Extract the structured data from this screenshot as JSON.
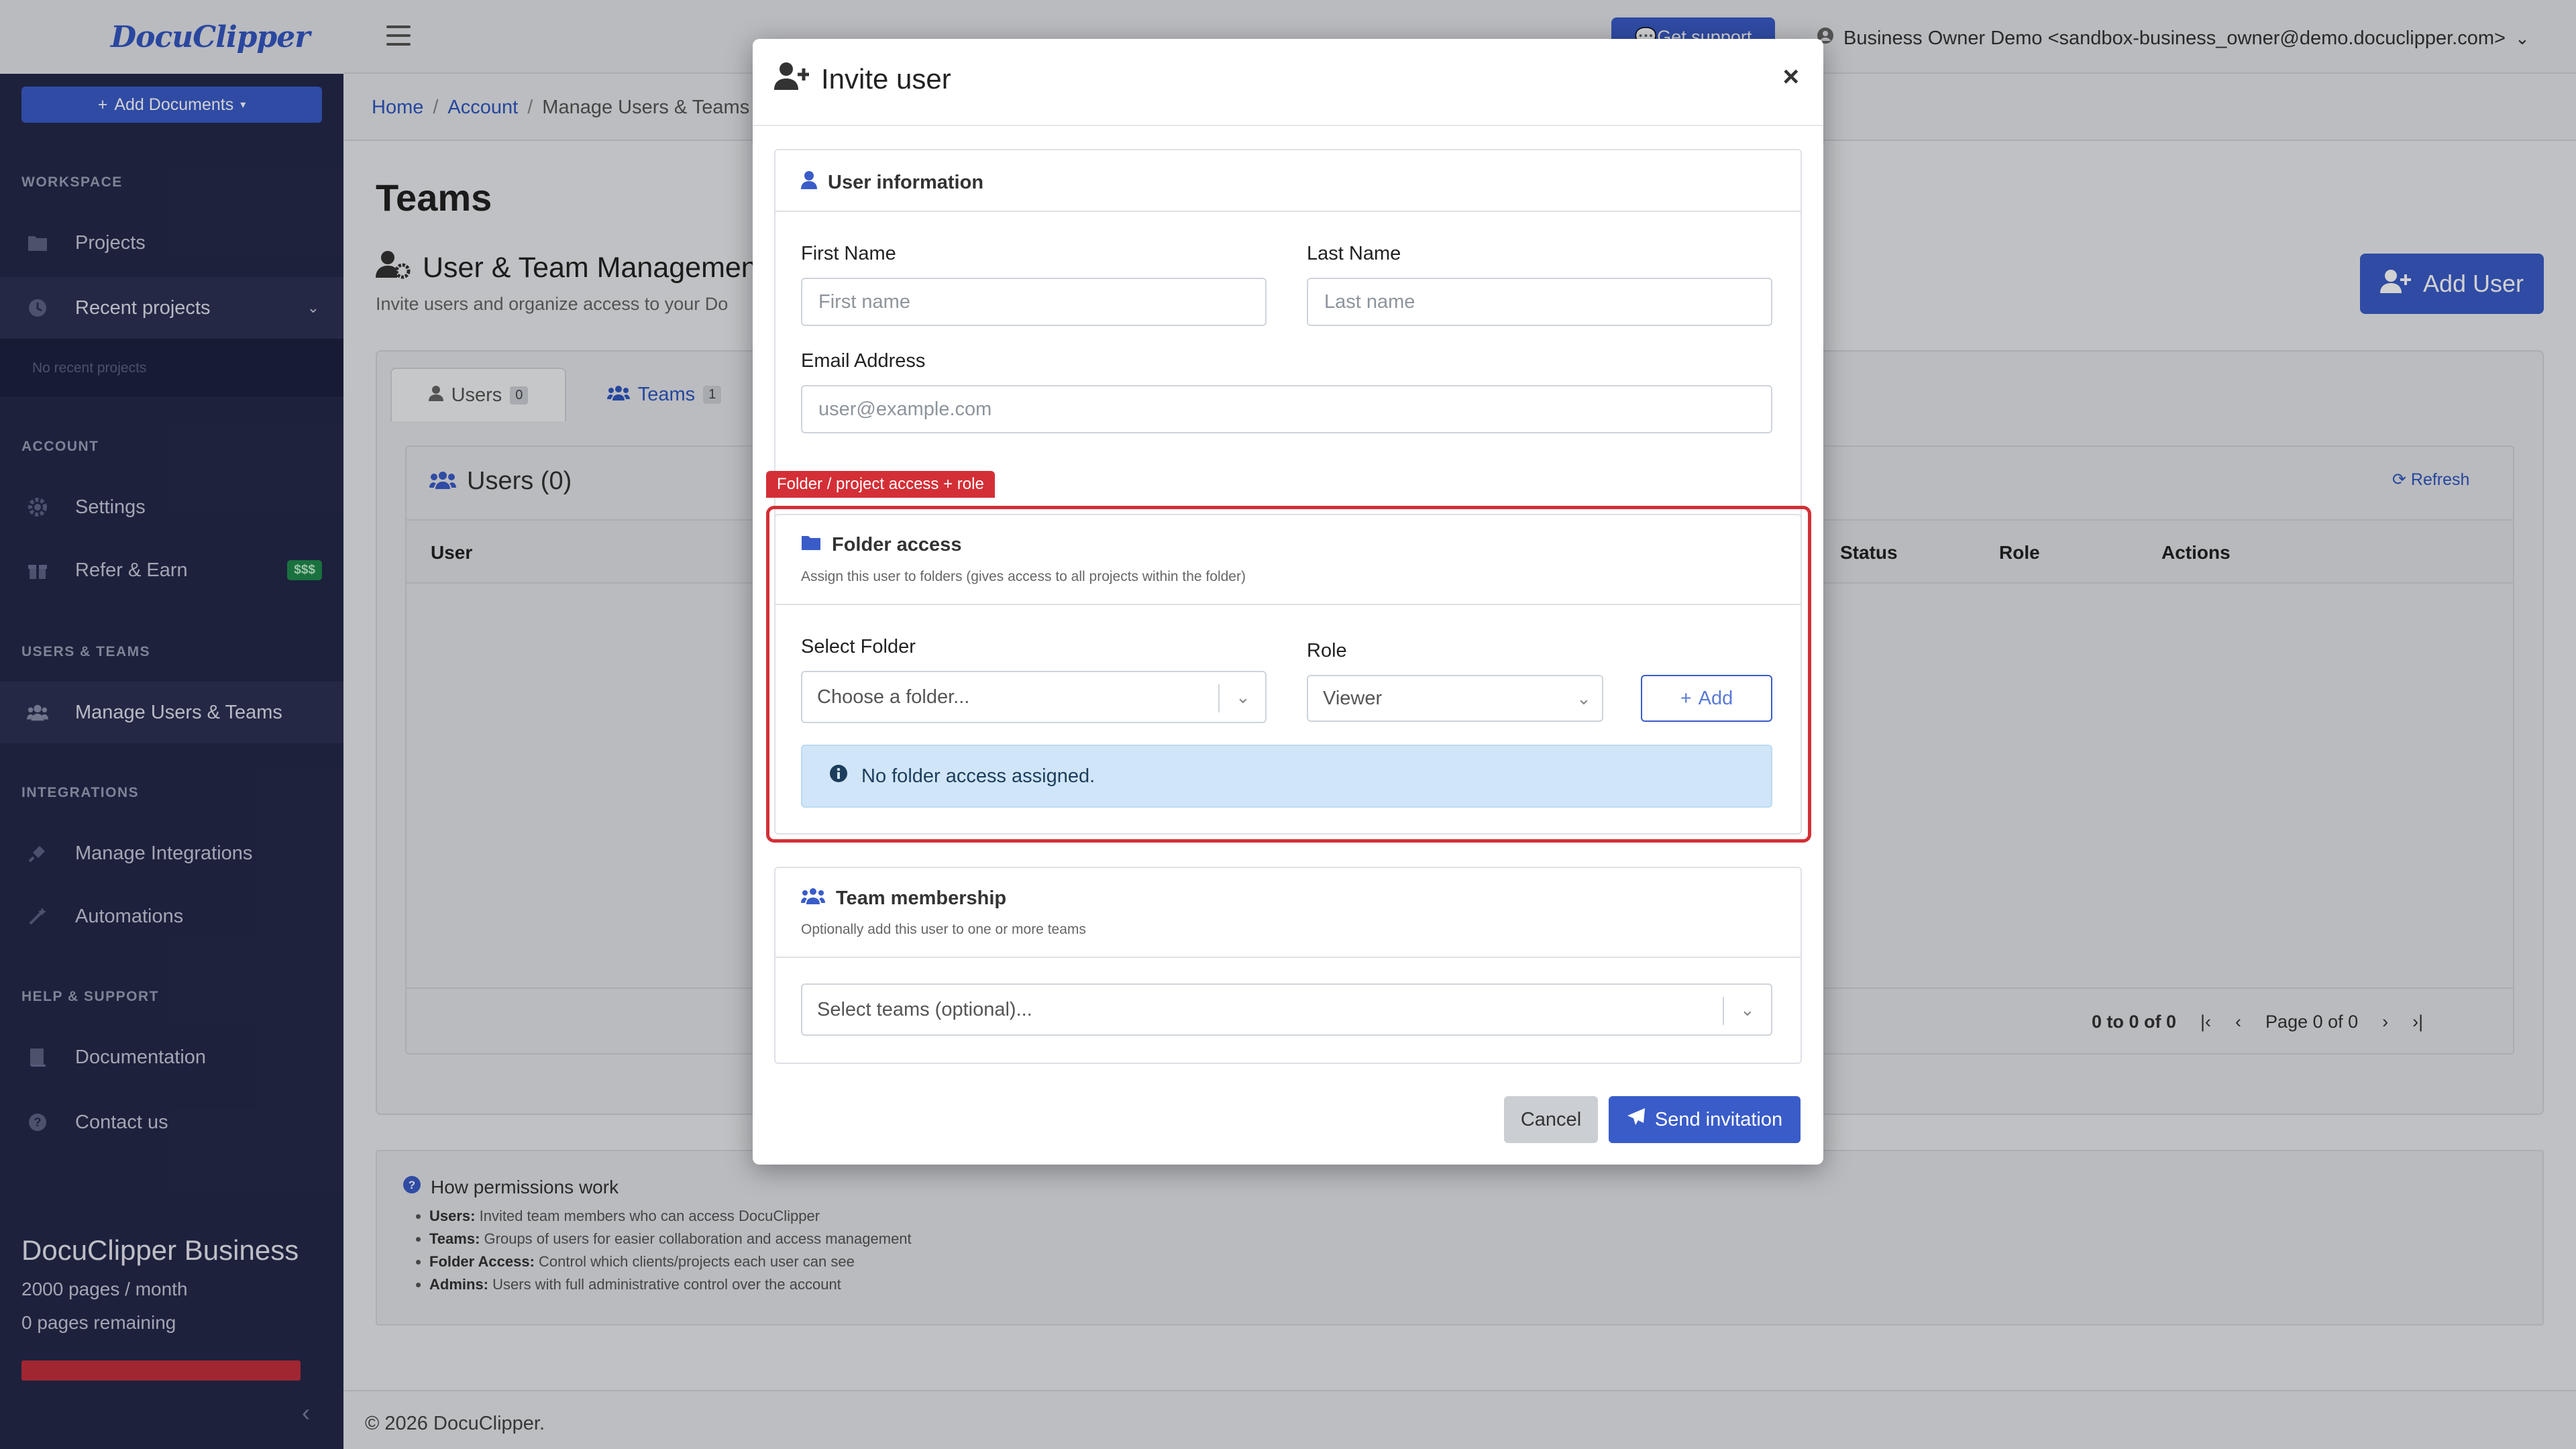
{
  "app": {
    "logo": "DocuClipper",
    "add_documents": "Add Documents"
  },
  "sidebar": {
    "sections": {
      "workspace": "WORKSPACE",
      "account": "ACCOUNT",
      "users_teams": "USERS & TEAMS",
      "integrations": "INTEGRATIONS",
      "help": "HELP & SUPPORT"
    },
    "items": {
      "projects": "Projects",
      "recent_projects": "Recent projects",
      "no_recent": "No recent projects",
      "settings": "Settings",
      "refer_earn": "Refer & Earn",
      "refer_badge": "$$$",
      "manage_users_teams": "Manage Users & Teams",
      "manage_integrations": "Manage Integrations",
      "automations": "Automations",
      "documentation": "Documentation",
      "contact_us": "Contact us"
    },
    "plan": {
      "name": "DocuClipper Business",
      "pages_per_month": "2000 pages / month",
      "pages_remaining": "0 pages remaining"
    }
  },
  "topbar": {
    "get_support": "Get support",
    "user": "Business Owner Demo <sandbox-business_owner@demo.docuclipper.com>"
  },
  "breadcrumb": {
    "home": "Home",
    "account": "Account",
    "current": "Manage Users & Teams"
  },
  "page": {
    "title": "Teams",
    "section_title": "User & Team Management",
    "section_sub": "Invite users and organize access to your Do",
    "add_user": "Add User",
    "tabs": {
      "users": "Users",
      "users_count": "0",
      "teams": "Teams",
      "teams_count": "1"
    },
    "users_header": "Users (0)",
    "refresh": "Refresh",
    "columns": {
      "user": "User",
      "status": "Status",
      "role": "Role",
      "actions": "Actions"
    },
    "pager": {
      "range": "0 to 0 of 0",
      "page": "Page 0 of 0"
    },
    "permissions": {
      "title": "How permissions work",
      "users_label": "Users:",
      "users_text": "Invited team members who can access DocuClipper",
      "teams_label": "Teams:",
      "teams_text": "Groups of users for easier collaboration and access management",
      "folder_label": "Folder Access:",
      "folder_text": "Control which clients/projects each user can see",
      "admins_label": "Admins:",
      "admins_text": "Users with full administrative control over the account"
    },
    "footer": "© 2026 DocuClipper."
  },
  "modal": {
    "title": "Invite user",
    "user_info": {
      "title": "User information",
      "first_name_label": "First Name",
      "first_name_placeholder": "First name",
      "last_name_label": "Last Name",
      "last_name_placeholder": "Last name",
      "email_label": "Email Address",
      "email_placeholder": "user@example.com"
    },
    "highlight_tag": "Folder / project access + role",
    "folder_access": {
      "title": "Folder access",
      "subtitle": "Assign this user to folders (gives access to all projects within the folder)",
      "select_folder_label": "Select Folder",
      "select_folder_placeholder": "Choose a folder...",
      "role_label": "Role",
      "role_value": "Viewer",
      "add": "Add",
      "empty_alert": "No folder access assigned."
    },
    "team_membership": {
      "title": "Team membership",
      "subtitle": "Optionally add this user to one or more teams",
      "select_placeholder": "Select teams (optional)..."
    },
    "cancel": "Cancel",
    "send": "Send invitation"
  },
  "colors": {
    "primary": "#3a5cc9",
    "sidebar": "#24294a",
    "highlight": "#d42f36",
    "info_alert": "#d0e6f8"
  }
}
